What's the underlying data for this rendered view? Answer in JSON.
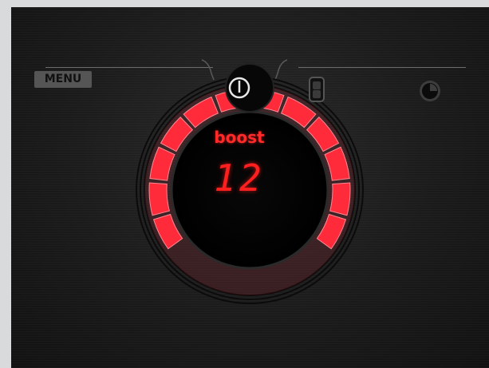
{
  "menu": {
    "label": "MENU"
  },
  "controls": {
    "power_icon": "power-icon",
    "lock_icon": "child-lock-icon",
    "timer_icon": "timer-icon"
  },
  "display": {
    "mode": "boost",
    "level": "12"
  },
  "dial": {
    "segments_total": 12,
    "segments_lit": 12
  },
  "colors": {
    "accent": "#ff2a3a",
    "panel": "#1c1c1c",
    "frame": "#d9dadb"
  }
}
